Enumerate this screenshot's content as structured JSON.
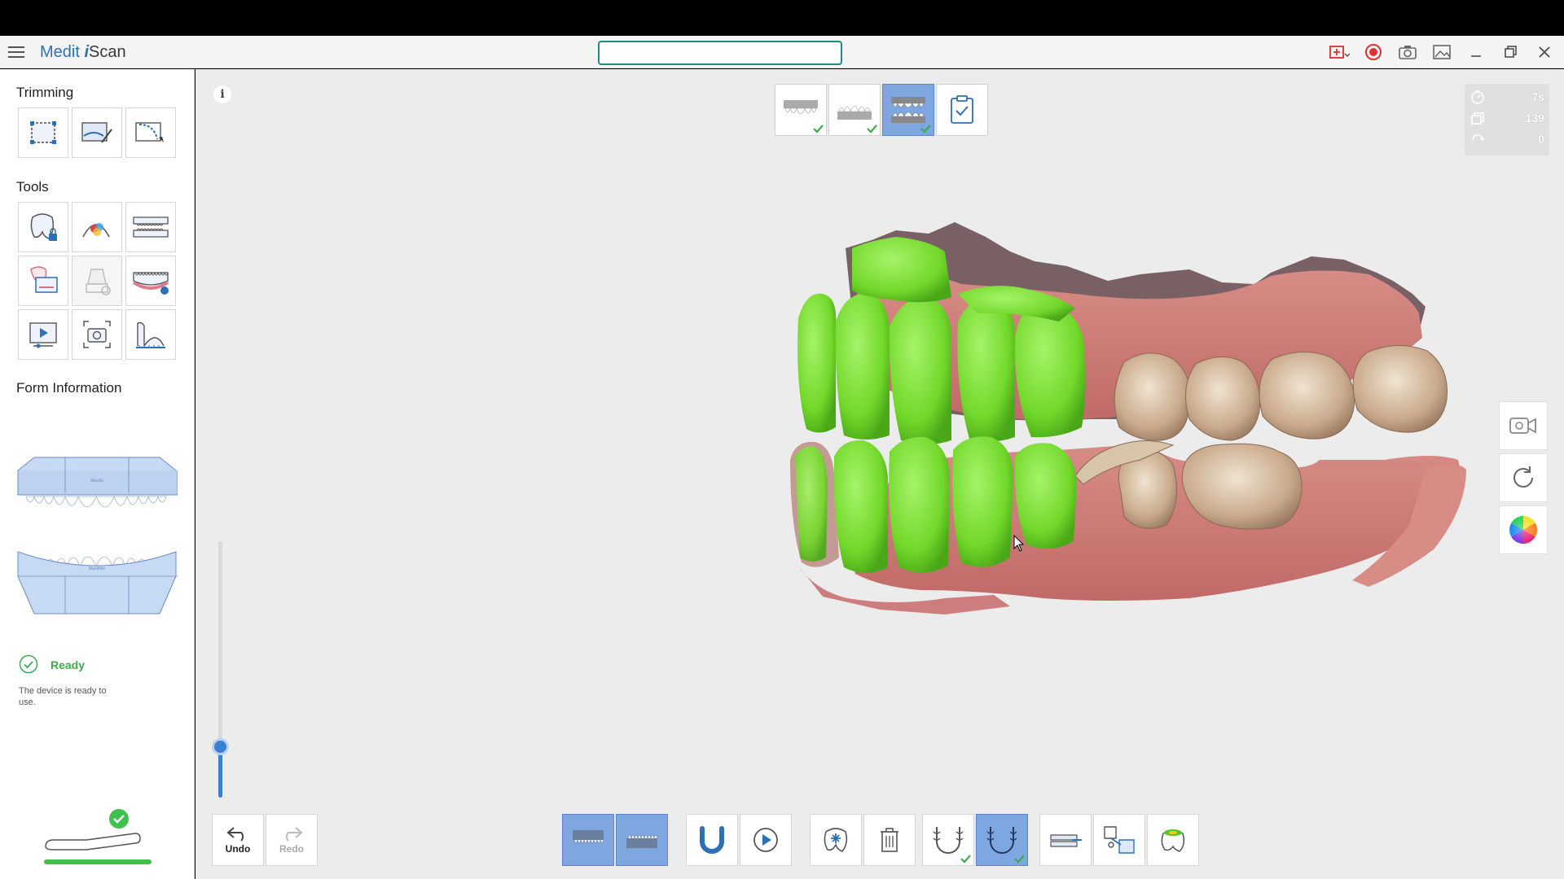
{
  "app": {
    "brand_main": "Medit",
    "brand_i": "i",
    "brand_scan": "Scan"
  },
  "search": {
    "value": "",
    "placeholder": ""
  },
  "titlebar_icons": [
    "scan-mode-icon",
    "record-icon",
    "camera-icon",
    "image-icon",
    "minimize-icon",
    "restore-icon",
    "close-icon"
  ],
  "colors": {
    "accent": "#3a7fd0",
    "active_bg": "#7ea6e0",
    "ready_green": "#3fa94f",
    "scan_green": "#7ee12a",
    "teal": "#1f8a86"
  },
  "sidebar": {
    "trimming_title": "Trimming",
    "trimming_tools": [
      "trim-rectangle-icon",
      "trim-lasso-icon",
      "trim-brush-icon"
    ],
    "tools_title": "Tools",
    "tools": [
      "tooth-lock-icon",
      "color-filter-icon",
      "occlusion-icon",
      "margin-lock-icon",
      "abutment-icon",
      "gingiva-lock-icon",
      "video-icon",
      "photo-icon",
      "measure-icon"
    ],
    "form_title": "Form Information",
    "status_label": "Ready",
    "status_desc": "The device is ready to use."
  },
  "stats": {
    "time": "7s",
    "count": "139",
    "rotations": "0"
  },
  "undo": {
    "label": "Undo"
  },
  "redo": {
    "label": "Redo"
  },
  "slider": {
    "level": 0.2
  }
}
